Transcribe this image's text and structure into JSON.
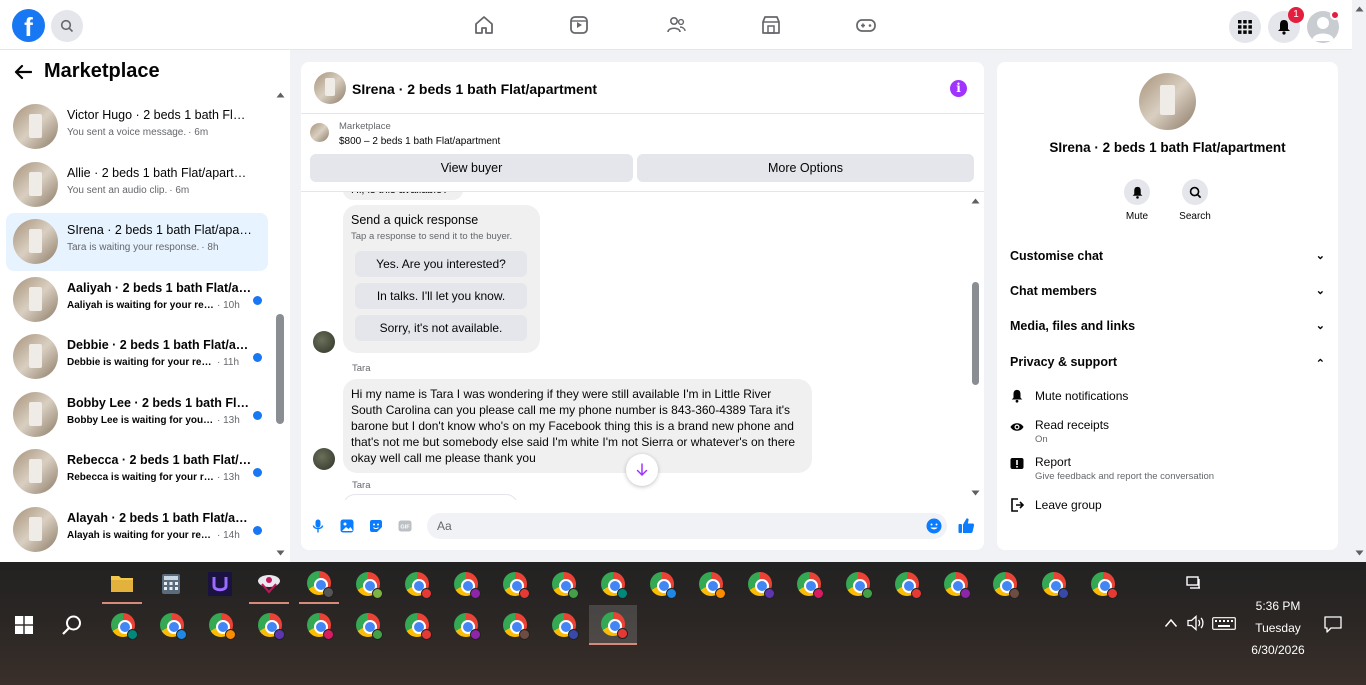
{
  "app": {
    "logo_letter": "f",
    "notifications_count": "1"
  },
  "sidebar": {
    "title": "Marketplace",
    "conversations": [
      {
        "name": "Victor Hugo · 2 beds 1 bath Flat/apartment",
        "preview": "You sent a voice message.",
        "time": "· 6m",
        "unread": false
      },
      {
        "name": "Allie · 2 beds 1 bath Flat/apartment",
        "preview": "You sent an audio clip.",
        "time": "· 6m",
        "unread": false
      },
      {
        "name": "SIrena · 2 beds 1 bath Flat/apartment",
        "preview": "Tara is waiting your response.",
        "time": "· 8h",
        "unread": false,
        "active": true
      },
      {
        "name": "Aaliyah · 2 beds 1 bath Flat/apartment",
        "preview": "Aaliyah is waiting for your response",
        "time": "· 10h",
        "unread": true
      },
      {
        "name": "Debbie · 2 beds 1 bath Flat/apartment",
        "preview": "Debbie is waiting for your response",
        "time": "· 11h",
        "unread": true
      },
      {
        "name": "Bobby Lee · 2 beds 1 bath Flat/apartment",
        "preview": "Bobby Lee is waiting for your response",
        "time": "· 13h",
        "unread": true
      },
      {
        "name": "Rebecca · 2 beds 1 bath Flat/apartment",
        "preview": "Rebecca is waiting for your response",
        "time": "· 13h",
        "unread": true
      },
      {
        "name": "Alayah · 2 beds 1 bath Flat/apartment",
        "preview": "Alayah is waiting for your response",
        "time": "· 14h",
        "unread": true
      }
    ]
  },
  "chat": {
    "title": "SIrena · 2 beds 1 bath Flat/apartment",
    "marketplace_label": "Marketplace",
    "listing": "$800 – 2 beds 1 bath Flat/apartment",
    "view_buyer": "View buyer",
    "more_options": "More Options",
    "prev_message": "Hi, is this available?",
    "quick_response": {
      "title": "Send a quick response",
      "subtitle": "Tap a response to send it to the buyer.",
      "options": [
        "Yes. Are you interested?",
        "In talks. I'll let you know.",
        "Sorry, it's not available."
      ]
    },
    "sender": "Tara",
    "message": "Hi my name is Tara I was wondering if they were still available I'm in Little River South Carolina can you please call me my phone number is 843-360-4389 Tara it's barone but I don't know who's on my Facebook thing this is a brand new phone and that's not me but somebody else said I'm white I'm not Sierra or whatever's on there okay well call me please thank you",
    "sender2": "Tara",
    "composer_placeholder": "Aa"
  },
  "details": {
    "title": "SIrena · 2 beds 1 bath Flat/apartment",
    "mute_label": "Mute",
    "search_label": "Search",
    "sections": [
      "Customise chat",
      "Chat members",
      "Media, files and links",
      "Privacy & support"
    ],
    "mute_notifications": "Mute notifications",
    "read_receipts": "Read receipts",
    "read_receipts_state": "On",
    "report": "Report",
    "report_sub": "Give feedback and report the conversation",
    "leave_group": "Leave group"
  },
  "taskbar": {
    "time": "5:36 PM",
    "day": "Tuesday",
    "date": "6/30/2026"
  },
  "colors": {
    "brand": "#1877f2",
    "accent_purple": "#a033ff",
    "unread_dot": "#1877f2",
    "badge": "#e41e3f"
  }
}
